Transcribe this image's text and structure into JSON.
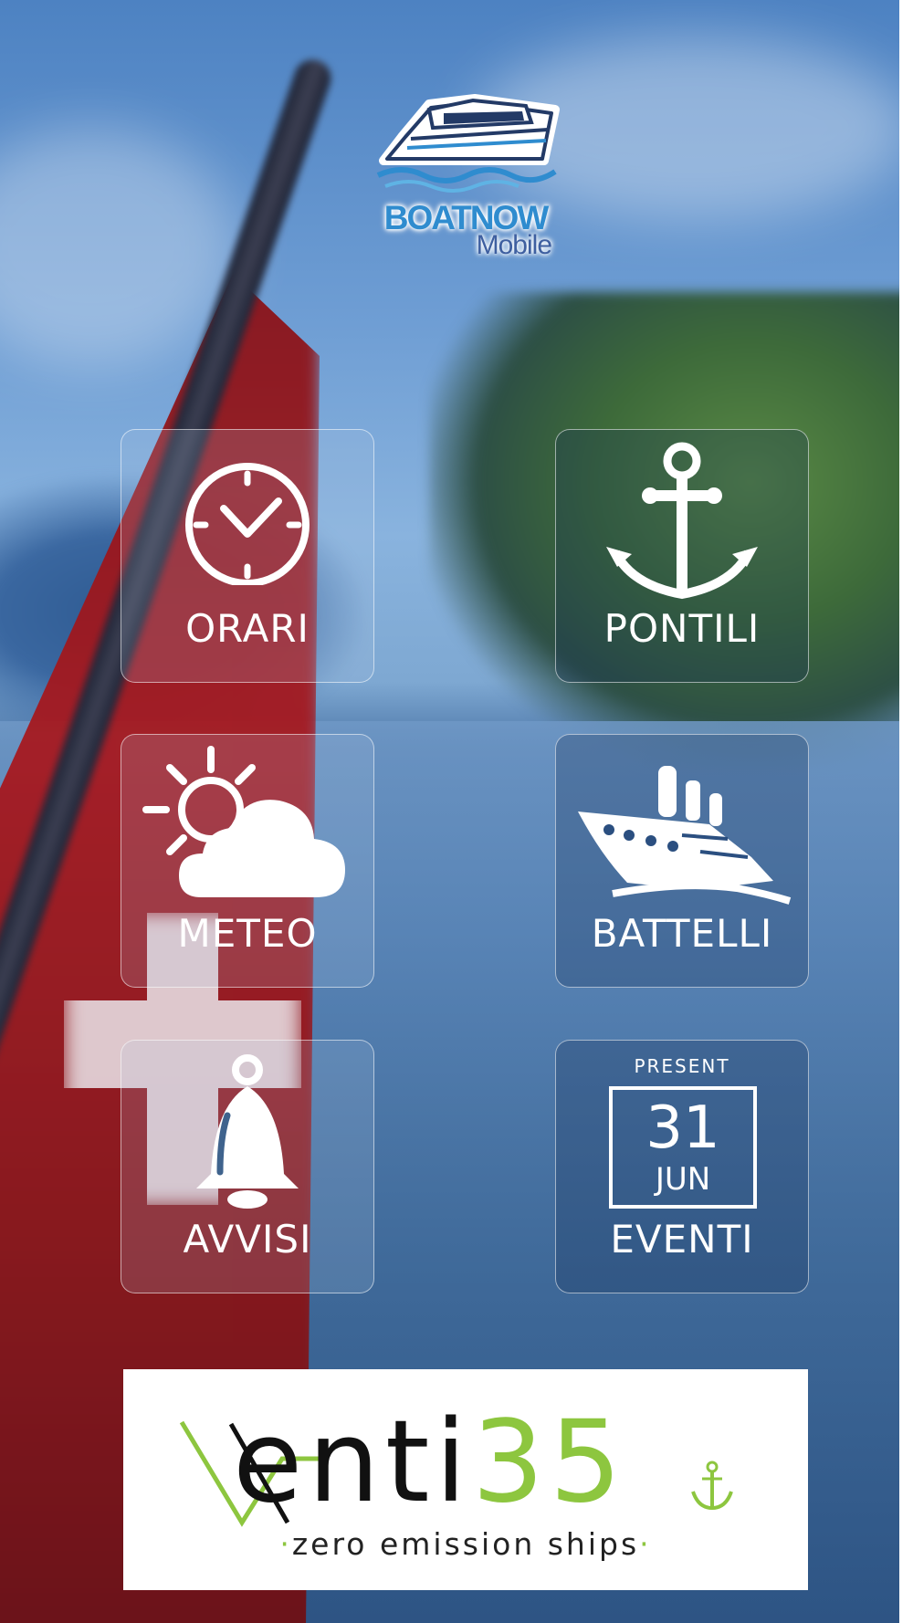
{
  "app": {
    "logo": {
      "word1": "BOATNOW",
      "word2": "Mobile"
    }
  },
  "menu": [
    {
      "label": "ORARI",
      "icon": "clock-icon"
    },
    {
      "label": "PONTILI",
      "icon": "anchor-icon"
    },
    {
      "label": "METEO",
      "icon": "weather-sun-cloud-icon"
    },
    {
      "label": "BATTELLI",
      "icon": "ship-icon"
    },
    {
      "label": "AVVISI",
      "icon": "bell-icon"
    },
    {
      "label": "EVENTI",
      "icon": "calendar-icon",
      "calendar": {
        "header": "PRESENT",
        "day": "31",
        "month": "JUN"
      }
    }
  ],
  "sponsor": {
    "brand_prefix": "enti",
    "brand_number": "35",
    "tagline": "zero emission ships",
    "accent_color": "#8dc63f"
  }
}
